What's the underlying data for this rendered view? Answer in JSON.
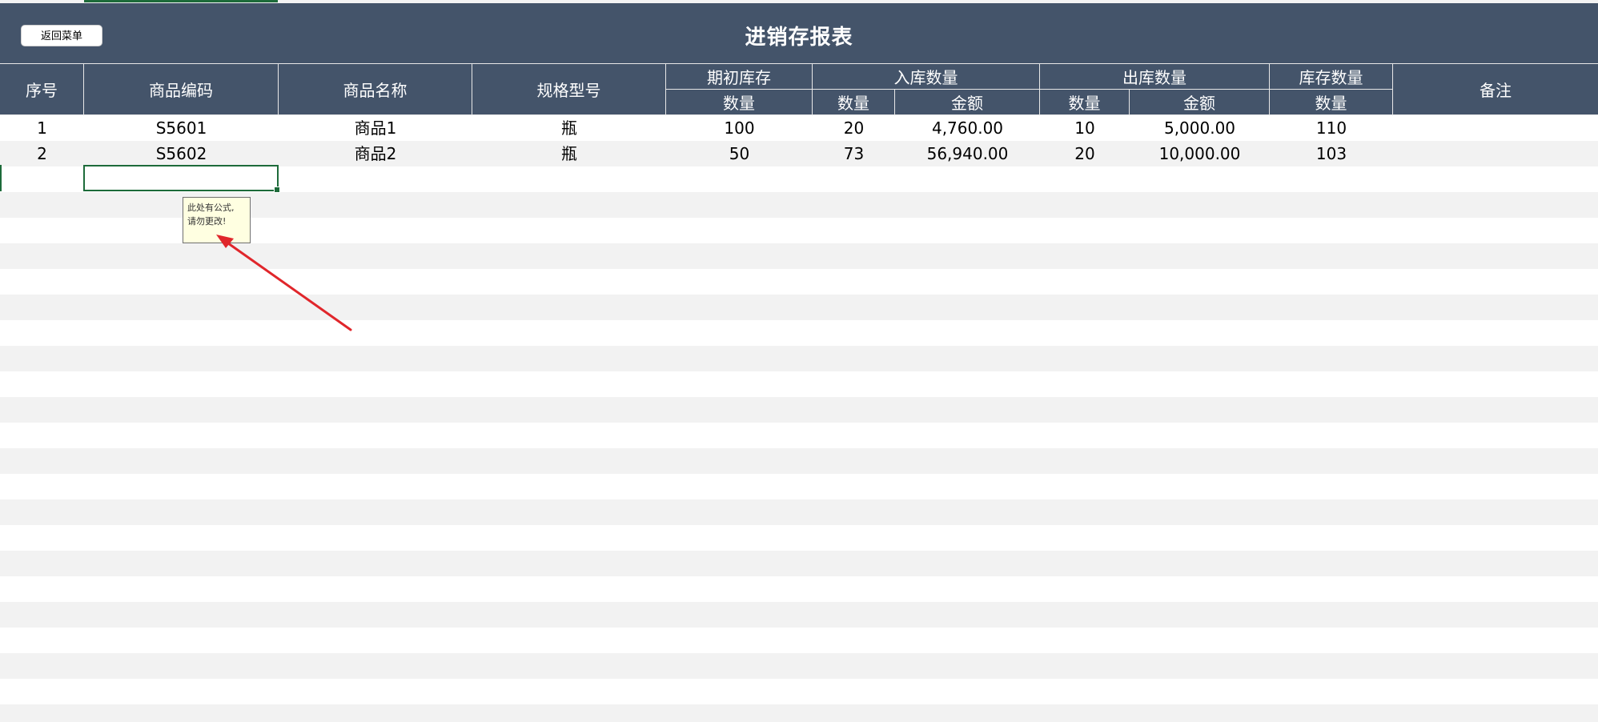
{
  "toolbar": {
    "back_label": "返回菜单"
  },
  "report": {
    "title": "进销存报表"
  },
  "headers": {
    "seq": "序号",
    "code": "商品编码",
    "name": "商品名称",
    "spec": "规格型号",
    "opening": "期初库存",
    "inbound": "入库数量",
    "outbound": "出库数量",
    "stock": "库存数量",
    "remark": "备注",
    "qty": "数量",
    "amount": "金额"
  },
  "rows": [
    {
      "seq": "1",
      "code": "S5601",
      "name": "商品1",
      "spec": "瓶",
      "opening_qty": "100",
      "in_qty": "20",
      "in_amount": "4,760.00",
      "out_qty": "10",
      "out_amount": "5,000.00",
      "stock_qty": "110"
    },
    {
      "seq": "2",
      "code": "S5602",
      "name": "商品2",
      "spec": "瓶",
      "opening_qty": "50",
      "in_qty": "73",
      "in_amount": "56,940.00",
      "out_qty": "20",
      "out_amount": "10,000.00",
      "stock_qty": "103"
    }
  ],
  "comment": {
    "line1": "此处有公式,",
    "line2": "请勿更改!"
  },
  "colors": {
    "header_bg": "#44546a",
    "stripe": "#f2f2f2",
    "selection": "#1d6b3a",
    "comment_bg": "#ffffe1",
    "arrow": "#e0262b"
  }
}
